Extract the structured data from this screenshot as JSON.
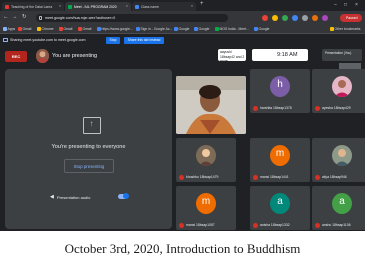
{
  "browser": {
    "tabs": [
      {
        "label": "Teaching of the Dalai Lama",
        "active": false,
        "favicon_color": "#e53935"
      },
      {
        "label": "Meet - IUL PROGRAM 2020",
        "active": true,
        "favicon_color": "#00ac47"
      },
      {
        "label": "Class name",
        "active": false,
        "favicon_color": "#4285f4"
      }
    ],
    "url": "meet.google.com/hua-mjzr-wex?authuser=0",
    "profile_status": "Paused",
    "bookmarks": [
      {
        "label": "Apps",
        "color": "#8ab4f8"
      },
      {
        "label": "Gmail",
        "color": "#ea4335"
      },
      {
        "label": "Chrome",
        "color": "#fbbc04"
      },
      {
        "label": "Gmail",
        "color": "#ea4335"
      },
      {
        "label": "Gmail",
        "color": "#ea4335"
      },
      {
        "label": "https://www.google...",
        "color": "#4285f4"
      },
      {
        "label": "Sign in - Google Ac...",
        "color": "#4285f4"
      },
      {
        "label": "Google",
        "color": "#4285f4"
      },
      {
        "label": "Google",
        "color": "#4285f4"
      },
      {
        "label": "MOS India - Meet...",
        "color": "#00ac47"
      },
      {
        "label": "Google",
        "color": "#4285f4"
      },
      {
        "label": "Other bookmarks",
        "color": "#fbbc04"
      }
    ]
  },
  "share_bar": {
    "message": "Sharing meet.youtube.com to meet.google.com",
    "stop_label": "Stop",
    "share_this_label": "Share this tab instead"
  },
  "meet": {
    "rec_label": "REC",
    "presenting_label": "You are presenting",
    "participant_summary": "aayushi 18bsap42 and 2 more",
    "time": "9:18 AM",
    "presenter_label": "Presentation (You)",
    "stage": {
      "message": "You're presenting to everyone",
      "stop_button": "Stop presenting",
      "audio_label": "Presentation audio"
    },
    "participants": [
      {
        "letter": "h",
        "color": "#7b5ea7",
        "name": "harshita 18bsap1378",
        "photo": false
      },
      {
        "letter": "",
        "color": "#c2185b",
        "name": "ayesha 18bsap429",
        "photo": true
      },
      {
        "letter": "",
        "color": "#5d4037",
        "name": "khushbu 18bsap1479",
        "photo": true
      },
      {
        "letter": "m",
        "color": "#ef6c00",
        "name": "mansi 18bsap1441",
        "photo": false
      },
      {
        "letter": "",
        "color": "#455a64",
        "name": "aliya 18bsap946",
        "photo": true
      },
      {
        "letter": "m",
        "color": "#ef6c00",
        "name": "mansi 18bsap1057",
        "photo": false
      },
      {
        "letter": "a",
        "color": "#00897b",
        "name": "anisha 18bsap1332",
        "photo": false
      },
      {
        "letter": "a",
        "color": "#43a047",
        "name": "anshu 18bsap1106",
        "photo": false
      }
    ]
  },
  "caption": "October 3rd, 2020, Introduction to Buddhism"
}
